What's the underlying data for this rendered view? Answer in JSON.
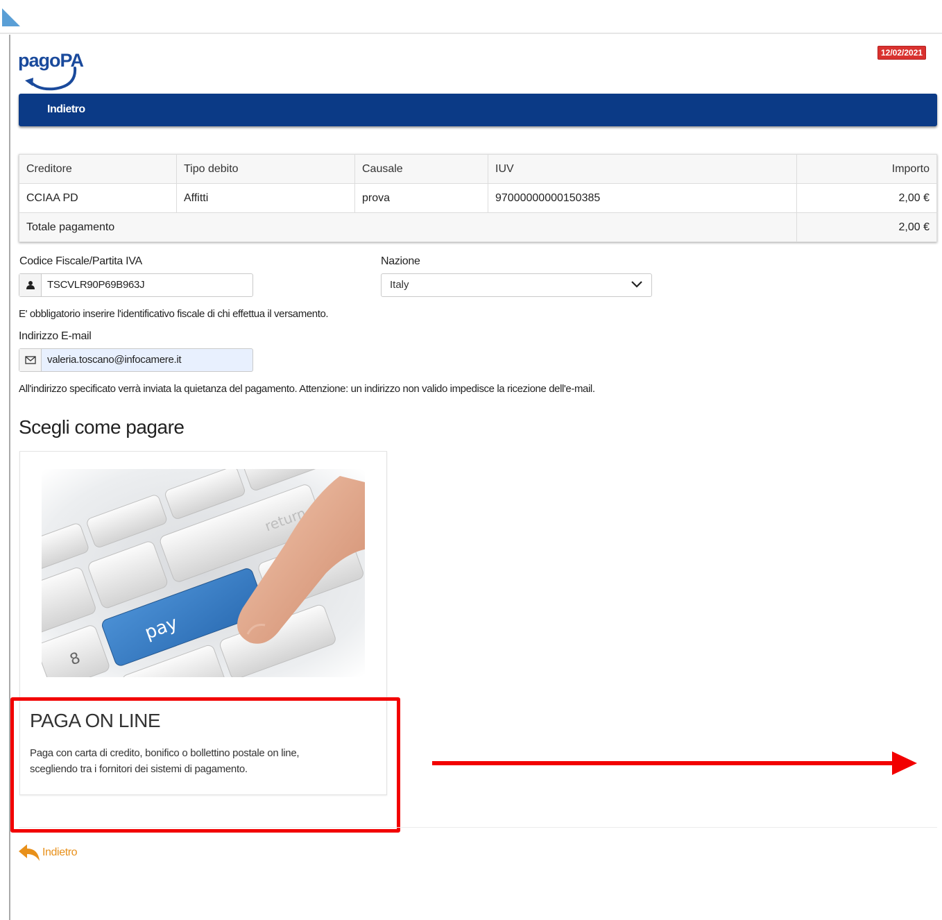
{
  "header": {
    "logo_text": "pagoPA",
    "date": "12/02/2021",
    "nav_back_label": "Indietro"
  },
  "table": {
    "headers": [
      "Creditore",
      "Tipo debito",
      "Causale",
      "IUV",
      "Importo"
    ],
    "rows": [
      [
        "CCIAA PD",
        "Affitti",
        "prova",
        "97000000000150385",
        "2,00 €"
      ]
    ],
    "total_label": "Totale pagamento",
    "total_value": "2,00 €"
  },
  "form": {
    "fiscal_label": "Codice Fiscale/Partita IVA",
    "fiscal_value": "TSCVLR90P69B963J",
    "country_label": "Nazione",
    "country_value": "Italy",
    "fiscal_help": "E' obbligatorio inserire l'identificativo fiscale di chi effettua il versamento.",
    "email_label": "Indirizzo E-mail",
    "email_value": "valeria.toscano@infocamere.it",
    "email_help": "All'indirizzo specificato verrà inviata la quietanza del pagamento. Attenzione: un indirizzo non valido impedisce la ricezione dell'e-mail."
  },
  "payment": {
    "section_title": "Scegli come pagare",
    "image_key_labels": [
      "pay",
      "return"
    ],
    "option_title": "PAGA ON LINE",
    "option_desc_line1": "Paga con carta di credito, bonifico o bollettino postale on line,",
    "option_desc_line2": "scegliendo tra i fornitori dei sistemi di pagamento."
  },
  "footer": {
    "back_label": "Indietro"
  },
  "colors": {
    "navbar": "#0b3a86",
    "date_badge": "#d9322f",
    "highlight": "#f20000",
    "back_link": "#e8901a"
  }
}
